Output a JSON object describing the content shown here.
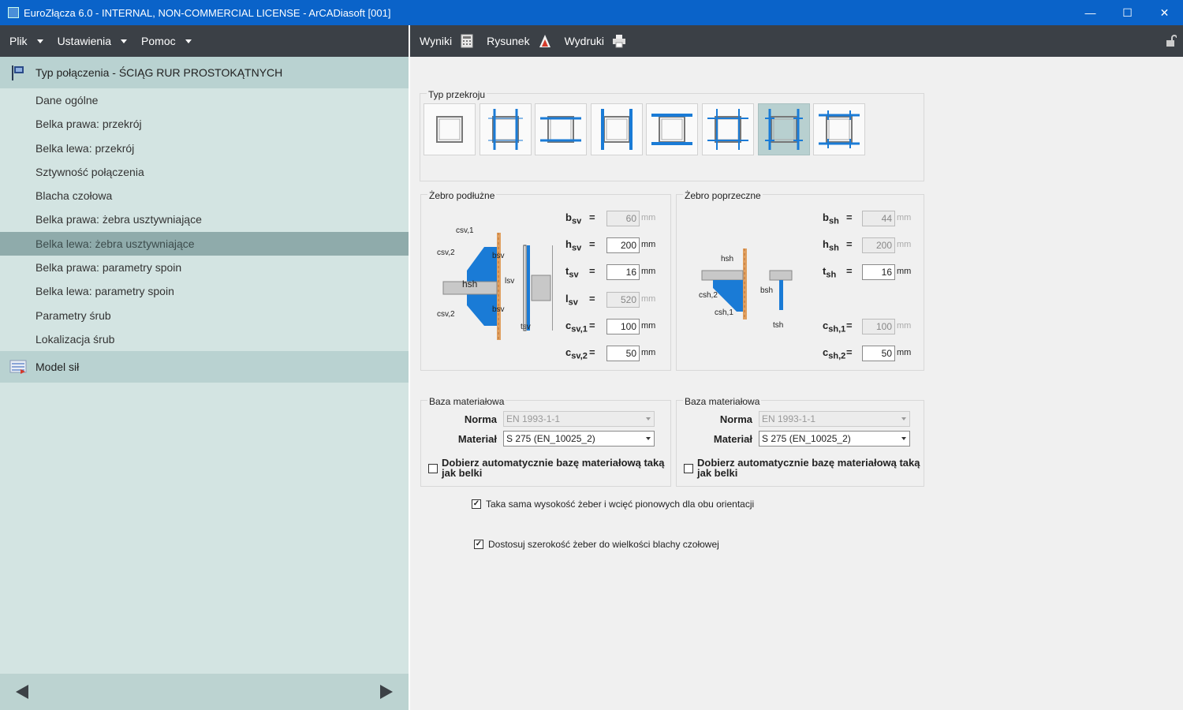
{
  "window": {
    "title": "EuroZłącza 6.0 - INTERNAL, NON-COMMERCIAL LICENSE - ArCADiasoft [001]",
    "minimize": "—",
    "maximize": "☐",
    "close": "✕"
  },
  "menu": [
    "Plik",
    "Ustawienia",
    "Pomoc"
  ],
  "toolbar": {
    "results": "Wyniki",
    "drawing": "Rysunek",
    "prints": "Wydruki"
  },
  "sidebar": {
    "header": "Typ połączenia - ŚCIĄG RUR PROSTOKĄTNYCH",
    "items": [
      "Dane ogólne",
      "Belka prawa: przekrój",
      "Belka lewa: przekrój",
      "Sztywność połączenia",
      "Blacha czołowa",
      "Belka prawa: żebra usztywniające",
      "Belka lewa: żebra usztywniające",
      "Belka prawa: parametry spoin",
      "Belka lewa: parametry spoin",
      "Parametry śrub",
      "Lokalizacja śrub"
    ],
    "active_index": 6,
    "section2": "Model sił"
  },
  "section_type": {
    "title": "Typ przekroju",
    "selected_index": 6,
    "count": 8
  },
  "long_rib": {
    "title": "Żebro podłużne",
    "params": [
      {
        "sym": "b",
        "sub": "sv",
        "value": "60",
        "unit": "mm",
        "disabled": true
      },
      {
        "sym": "h",
        "sub": "sv",
        "value": "200",
        "unit": "mm",
        "disabled": false
      },
      {
        "sym": "t",
        "sub": "sv",
        "value": "16",
        "unit": "mm",
        "disabled": false
      },
      {
        "sym": "l",
        "sub": "sv",
        "value": "520",
        "unit": "mm",
        "disabled": true
      },
      {
        "sym": "c",
        "sub": "sv,1",
        "value": "100",
        "unit": "mm",
        "disabled": false
      },
      {
        "sym": "c",
        "sub": "sv,2",
        "value": "50",
        "unit": "mm",
        "disabled": false
      }
    ]
  },
  "trans_rib": {
    "title": "Żebro poprzeczne",
    "params": [
      {
        "sym": "b",
        "sub": "sh",
        "value": "44",
        "unit": "mm",
        "disabled": true
      },
      {
        "sym": "h",
        "sub": "sh",
        "value": "200",
        "unit": "mm",
        "disabled": true
      },
      {
        "sym": "t",
        "sub": "sh",
        "value": "16",
        "unit": "mm",
        "disabled": false
      },
      {
        "sym": "c",
        "sub": "sh,1",
        "value": "100",
        "unit": "mm",
        "disabled": true
      },
      {
        "sym": "c",
        "sub": "sh,2",
        "value": "50",
        "unit": "mm",
        "disabled": false
      }
    ]
  },
  "material_left": {
    "title": "Baza materiałowa",
    "norm_label": "Norma",
    "norm_value": "EN 1993-1-1",
    "mat_label": "Materiał",
    "mat_value": "S 275 (EN_10025_2)",
    "auto_label_1": "Dobierz automatycznie bazę materiałową taką",
    "auto_label_2": "jak belki",
    "auto_checked": false
  },
  "material_right": {
    "title": "Baza materiałowa",
    "norm_label": "Norma",
    "norm_value": "EN 1993-1-1",
    "mat_label": "Materiał",
    "mat_value": "S 275 (EN_10025_2)",
    "auto_label_1": "Dobierz automatycznie bazę materiałową taką",
    "auto_label_2": "jak belki",
    "auto_checked": false
  },
  "options": {
    "same_height": "Taka sama wysokość żeber i wcięć pionowych dla obu orientacji",
    "same_height_checked": true,
    "adjust_width": "Dostosuj szerokość żeber do wielkości blachy czołowej",
    "adjust_width_checked": true
  },
  "diagram_labels": {
    "csv1": "csv,1",
    "csv2": "csv,2",
    "bsv": "bsv",
    "hsh": "hsh",
    "lsv": "lsv",
    "tsv": "tsv",
    "hsh2": "hsh",
    "bsh": "bsh",
    "csh2": "csh,2",
    "csh1": "csh,1",
    "tsh": "tsh"
  },
  "colors": {
    "titlebar": "#0a63c9",
    "menubar": "#3b4046",
    "sidebar": "#d3e4e2",
    "sidebar_active": "#8fabab",
    "rib_blue": "#1a7bd6"
  }
}
